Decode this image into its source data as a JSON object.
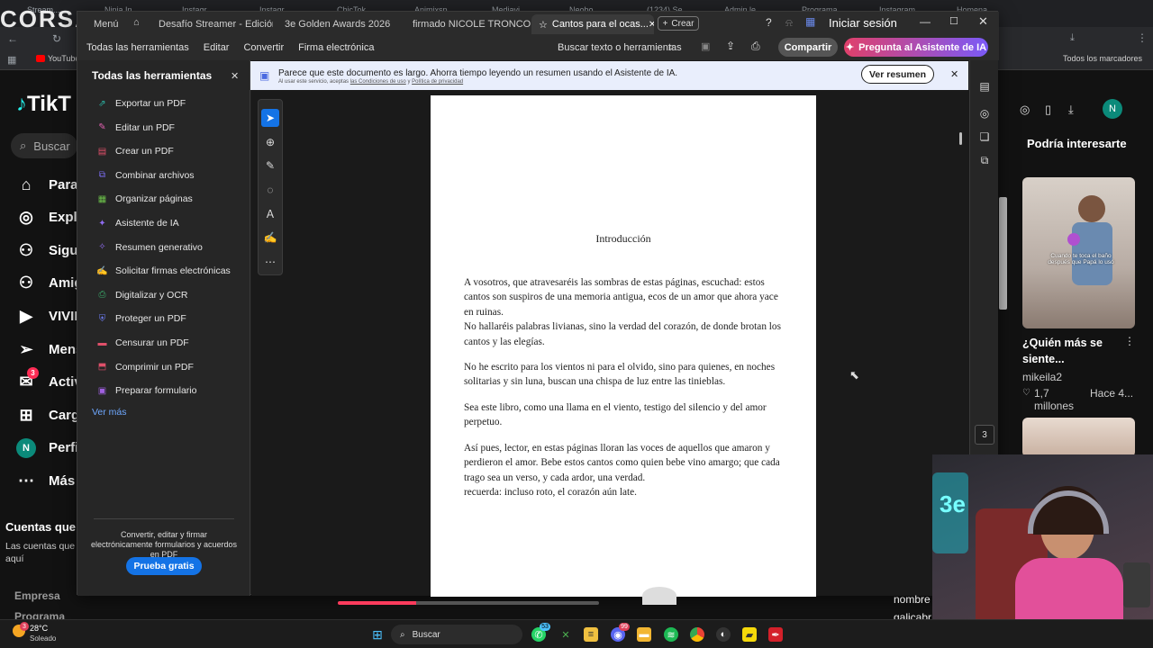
{
  "background_browser": {
    "tabs": [
      "Stream...",
      "Ninja In...",
      "Instagr...",
      "Instagr...",
      "ChicTok...",
      "Animixsp...",
      "Mediavi...",
      "Neobo...",
      "(1234) Se...",
      "Admin le...",
      "Programa...",
      "Instagram",
      "Homena..."
    ],
    "bookmarks": {
      "youtube": "YouTube",
      "all_bookmarks": "Todos los marcadores"
    },
    "watermark": "CORSAIR"
  },
  "tiktok": {
    "logo": "TikT",
    "search_placeholder": "Buscar",
    "nav": [
      {
        "label": "Para",
        "icon": "home-icon"
      },
      {
        "label": "Explo",
        "icon": "compass-icon"
      },
      {
        "label": "Sigui",
        "icon": "user-follow-icon"
      },
      {
        "label": "Amig",
        "icon": "friends-icon"
      },
      {
        "label": "VIVIR",
        "icon": "live-icon"
      },
      {
        "label": "Mens",
        "icon": "send-icon"
      },
      {
        "label": "Activ",
        "icon": "inbox-icon",
        "badge": "3"
      },
      {
        "label": "Carga",
        "icon": "upload-icon"
      },
      {
        "label": "Perfil",
        "icon": "profile-icon",
        "avatar": "N"
      },
      {
        "label": "Más",
        "icon": "more-icon"
      }
    ],
    "accounts_title": "Cuentas que s",
    "accounts_sub": "Las cuentas que\naquí",
    "footer": [
      "Empresa",
      "Programa"
    ],
    "right": {
      "section_title": "Podría interesarte",
      "video_title": "¿Quién más se siente...",
      "video_author": "mikeila2",
      "video_likes": "1,7 millones",
      "video_time": "Hace 4...",
      "video_overlay": "Cuando te toca el baño después que Papá lo usó",
      "avatar_letter": "N"
    },
    "bottom_right": [
      "nombre",
      "galicabr"
    ]
  },
  "acrobat": {
    "tabs": [
      "Menú",
      "Desafío Streamer - Edición ...",
      "3e Golden Awards 2026",
      "firmado NICOLE TRONCO...",
      "Cantos para el ocas..."
    ],
    "new_tab": "Crear",
    "signin": "Iniciar sesión",
    "menu": [
      "Todas las herramientas",
      "Editar",
      "Convertir",
      "Firma electrónica"
    ],
    "search_label": "Buscar texto o herramientas",
    "share_button": "Compartir",
    "ai_button": "Pregunta al Asistente de IA",
    "panel": {
      "title": "Todas las herramientas",
      "tools": [
        {
          "label": "Exportar un PDF",
          "color": "#2bb3a3"
        },
        {
          "label": "Editar un PDF",
          "color": "#e060b0"
        },
        {
          "label": "Crear un PDF",
          "color": "#e0506a"
        },
        {
          "label": "Combinar archivos",
          "color": "#7b6cf0"
        },
        {
          "label": "Organizar páginas",
          "color": "#6cc04a"
        },
        {
          "label": "Asistente de IA",
          "color": "#8f6cf0"
        },
        {
          "label": "Resumen generativo",
          "color": "#8f6cf0"
        },
        {
          "label": "Solicitar firmas electrónicas",
          "color": "#c060e0"
        },
        {
          "label": "Digitalizar y OCR",
          "color": "#3aaa6a"
        },
        {
          "label": "Proteger un PDF",
          "color": "#6c7cf0"
        },
        {
          "label": "Censurar un PDF",
          "color": "#e0506a"
        },
        {
          "label": "Comprimir un PDF",
          "color": "#e0506a"
        },
        {
          "label": "Preparar formulario",
          "color": "#a060e0"
        }
      ],
      "see_more": "Ver más",
      "promo_text": "Convertir, editar y firmar electrónicamente formularios y acuerdos en PDF",
      "trial_button": "Prueba gratis"
    },
    "banner": {
      "message": "Parece que este documento es largo. Ahorra tiempo leyendo un resumen usando el Asistente de IA.",
      "fine_print": "Al usar este servicio, aceptas",
      "terms_link": "las Condiciones de uso",
      "and": "y",
      "privacy_link": "Política de privacidad",
      "action": "Ver resumen"
    },
    "page_number": "3",
    "document": {
      "heading": "Introducción",
      "paragraphs": [
        "A vosotros, que atravesaréis las sombras de estas páginas, escuchad: estos cantos son suspiros de una memoria antigua, ecos de un amor que ahora yace en ruinas.\nNo hallaréis palabras livianas, sino la verdad del corazón, de donde brotan los cantos y las elegías.",
        "No he escrito para los vientos ni para el olvido, sino para quienes, en noches solitarias y sin luna, buscan una chispa de luz entre las tinieblas.",
        "Sea este libro, como una llama en el viento, testigo del silencio y del amor perpetuo.",
        "Así pues, lector, en estas páginas lloran las voces de aquellos que amaron y perdieron el amor. Bebe estos cantos como quien bebe vino amargo; que cada trago sea un verso, y cada ardor, una verdad.\nrecuerda: incluso roto, el corazón aún late."
      ]
    }
  },
  "taskbar": {
    "weather_temp": "28°C",
    "weather_desc": "Soleado",
    "weather_badge": "3",
    "search_label": "Buscar",
    "whatsapp_badge": "53",
    "discord_badge": "99"
  }
}
